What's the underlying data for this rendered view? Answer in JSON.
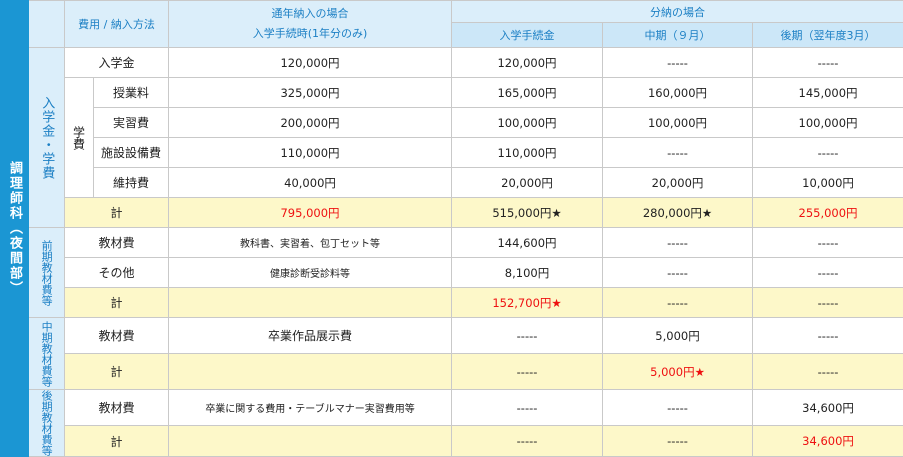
{
  "side_label": "調理師科（夜間部）",
  "header": {
    "corner": "費用 / 納入方法",
    "annual_line1": "通年納入の場合",
    "annual_line2": "入学手続時(1年分のみ)",
    "split_title": "分納の場合",
    "split_cols": [
      "入学手続金",
      "中期（９月）",
      "後期（翌年度3月）"
    ]
  },
  "sections": {
    "s1": "入学金・学費",
    "s2": "前期教材費等",
    "s3": "中期教材費等",
    "s4": "後期教材費等"
  },
  "gakuhi_label": "学費",
  "rows": {
    "nyugakukin": {
      "label": "入学金",
      "annual": "120,000円",
      "c1": "120,000円",
      "c2": "-----",
      "c3": "-----"
    },
    "jugyoryo": {
      "label": "授業料",
      "annual": "325,000円",
      "c1": "165,000円",
      "c2": "160,000円",
      "c3": "145,000円"
    },
    "jisshuhi": {
      "label": "実習費",
      "annual": "200,000円",
      "c1": "100,000円",
      "c2": "100,000円",
      "c3": "100,000円"
    },
    "shisetsu": {
      "label": "施設設備費",
      "annual": "110,000円",
      "c1": "110,000円",
      "c2": "-----",
      "c3": "-----"
    },
    "iji": {
      "label": "維持費",
      "annual": "40,000円",
      "c1": "20,000円",
      "c2": "20,000円",
      "c3": "10,000円"
    },
    "total1": {
      "label": "計",
      "annual": "795,000円",
      "c1": "515,000円★",
      "c2": "280,000円★",
      "c3": "255,000円"
    },
    "kyozai1": {
      "label": "教材費",
      "annual": "教科書、実習着、包丁セット等",
      "c1": "144,600円",
      "c2": "-----",
      "c3": "-----"
    },
    "sonota": {
      "label": "その他",
      "annual": "健康診断受診料等",
      "c1": "8,100円",
      "c2": "-----",
      "c3": "-----"
    },
    "total2": {
      "label": "計",
      "annual": "",
      "c1": "152,700円★",
      "c2": "-----",
      "c3": "-----"
    },
    "kyozai2": {
      "label": "教材費",
      "annual": "卒業作品展示費",
      "c1": "-----",
      "c2": "5,000円",
      "c3": "-----"
    },
    "total3": {
      "label": "計",
      "annual": "",
      "c1": "-----",
      "c2": "5,000円★",
      "c3": "-----"
    },
    "kyozai3": {
      "label": "教材費",
      "annual": "卒業に関する費用・テーブルマナー実習費用等",
      "c1": "-----",
      "c2": "-----",
      "c3": "34,600円"
    },
    "total4": {
      "label": "計",
      "annual": "",
      "c1": "-----",
      "c2": "-----",
      "c3": "34,600円"
    }
  },
  "colors": {
    "side": "#1b96d3",
    "header": "#dbeefa",
    "total_row": "#fdf8c9",
    "emphasis": "#ee1111"
  }
}
